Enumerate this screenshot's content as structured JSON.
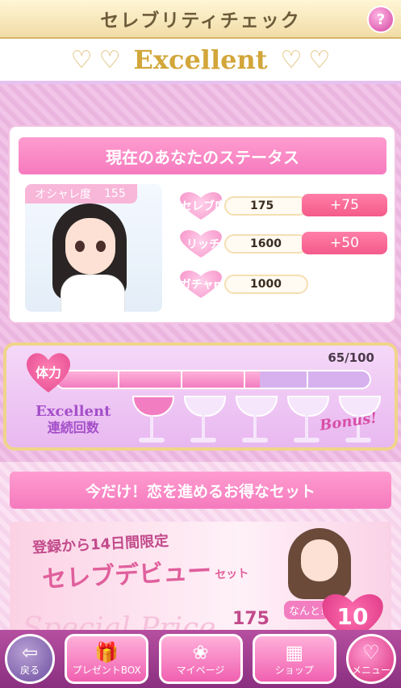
{
  "header": {
    "title": "セレブリティチェック",
    "help_icon": "?"
  },
  "rank": {
    "label": "Excellent"
  },
  "status": {
    "title": "現在のあなたのステータス",
    "fashion": {
      "label": "オシャレ度",
      "value": "155"
    },
    "stats": [
      {
        "name": "セレブ度",
        "value": "175",
        "bonus": "+75"
      },
      {
        "name": "リッチ",
        "value": "1600",
        "bonus": "+50"
      },
      {
        "name": "ガチャpt",
        "value": "1000",
        "bonus": ""
      }
    ]
  },
  "stamina": {
    "label": "体力",
    "value": "65/100",
    "fraction": 0.65,
    "segments": 5
  },
  "streak": {
    "label_en": "Excellent",
    "label_ja": "連続回数",
    "filled": 1,
    "total": 5,
    "bonus": "Bonus!"
  },
  "promo": {
    "title": "今だけ！恋を進めるお得なセット",
    "limited": "登録から14日間限定",
    "main": "セレブデビュー",
    "set": "セット",
    "special": "Special Price",
    "value": "175",
    "nanto": "なんと!",
    "big": "10"
  },
  "nav": {
    "back": "戻る",
    "present": "プレゼントBOX",
    "mypage": "マイページ",
    "shop": "ショップ",
    "menu": "メニュー"
  },
  "colors": {
    "accent": "#f57abe",
    "gold": "#d2a63a",
    "purple": "#a44fc9"
  }
}
